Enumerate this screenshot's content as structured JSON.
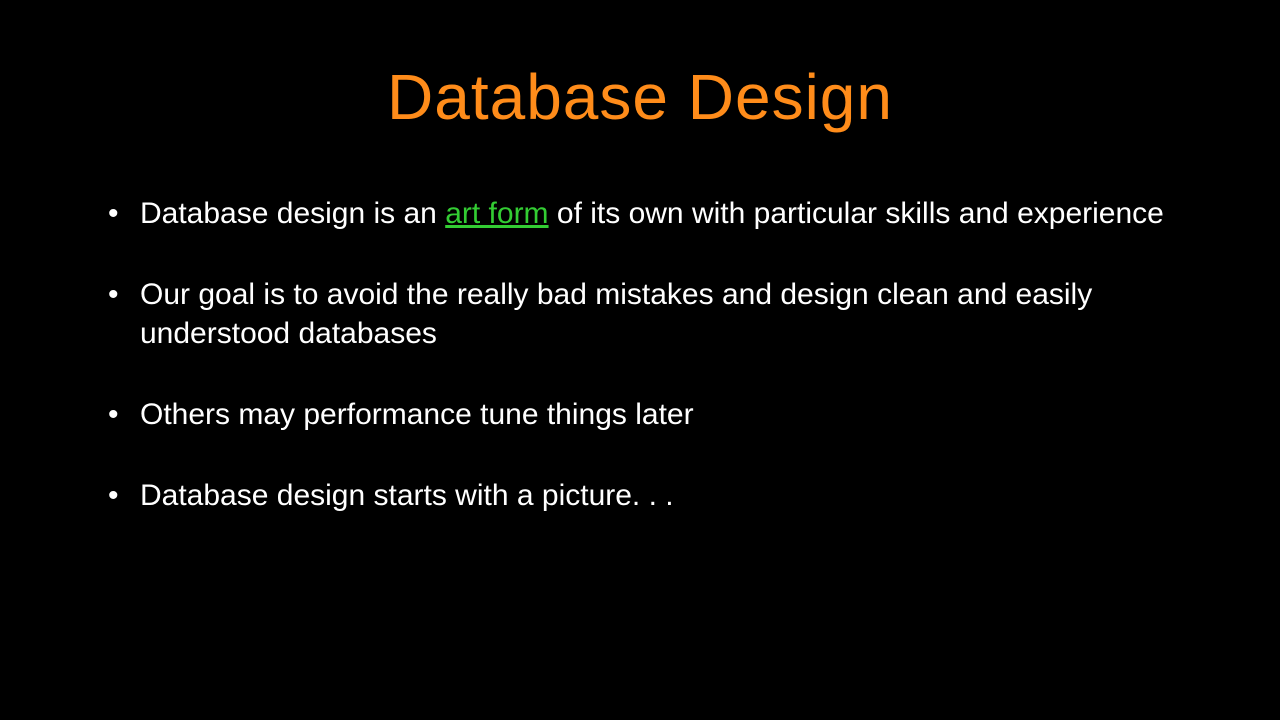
{
  "slide": {
    "title": "Database Design",
    "bullets": [
      {
        "before": "Database design is an ",
        "highlight": "art form",
        "after": " of its own with particular skills and experience"
      },
      {
        "before": "Our goal is to avoid the really bad mistakes and design clean and easily understood databases",
        "highlight": "",
        "after": ""
      },
      {
        "before": "Others may performance tune things later",
        "highlight": "",
        "after": ""
      },
      {
        "before": "Database design starts with a picture. . .",
        "highlight": "",
        "after": ""
      }
    ]
  }
}
